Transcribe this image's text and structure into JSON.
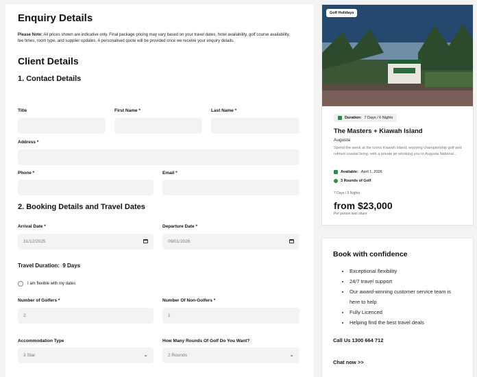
{
  "form": {
    "title": "Enquiry Details",
    "note_label": "Please Note:",
    "note_text": "All prices shown are indicative only. Final package pricing may vary based on your travel dates, hotel availability, golf course availability, tee times, room type, and supplier updates. A personalised quote will be provided once we receive your enquiry details.",
    "client_title": "Client Details",
    "contact_title": "1. Contact Details",
    "fields": {
      "title_label": "Title",
      "first_name_label": "First Name *",
      "last_name_label": "Last Name *",
      "address_label": "Address *",
      "phone_label": "Phone *",
      "email_label": "Email *"
    },
    "booking_title": "2. Booking Details and Travel Dates",
    "arrival_label": "Arrival Date *",
    "arrival_value": "31/12/2025",
    "departure_label": "Departure Date *",
    "departure_value": "09/01/2026",
    "duration_label": "Travel Duration:",
    "duration_value": "9 Days",
    "flexible_label": "I am flexible with my dates",
    "golfers_label": "Number of Golfers *",
    "golfers_value": "2",
    "non_golfers_label": "Number Of Non-Golfers *",
    "non_golfers_value": "1",
    "accommodation_label": "Accommodation Type",
    "accommodation_value": "3 Star",
    "rounds_label": "How Many Rounds Of Golf Do You Want?",
    "rounds_value": "2 Rounds"
  },
  "card": {
    "badge": "Golf Holidays",
    "duration_label": "Duration:",
    "duration_value": "7 Days / 6 Nights",
    "title": "The Masters + Kiawah Island",
    "location": "Augusta",
    "description": "Spend the week at the iconic Kiawah Island, enjoying championship golf and refined coastal living, with a private jet whisking you to Augusta National...",
    "available_label": "Available:",
    "available_value": "April 1, 2026",
    "rounds": "3 Rounds of Golf",
    "nights": "7 Days / 6 Nights",
    "price": "from $23,000",
    "price_note": "Per person twin share",
    "accent_color": "#2f8a4a"
  },
  "confidence": {
    "title": "Book with confidence",
    "items": [
      "Exceptional flexibility",
      "24/7 travel support",
      "Our award-winning customer service team is here to help",
      "Fully Licenced",
      "Helping find the best travel deals"
    ],
    "call": "Call Us 1300 664 712",
    "chat": "Chat now >>"
  }
}
